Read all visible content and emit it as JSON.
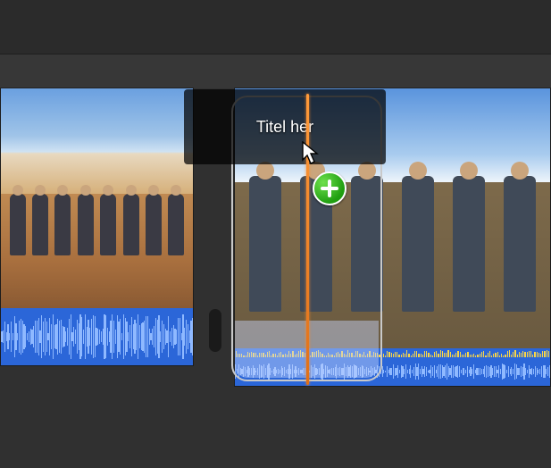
{
  "overlay": {
    "title_placeholder": "Titel her"
  },
  "badges": {
    "add": "add-icon"
  },
  "colors": {
    "audio_track": "#2b66d8",
    "plus_badge": "#1f9e10",
    "playhead": "#ff8a2a"
  }
}
